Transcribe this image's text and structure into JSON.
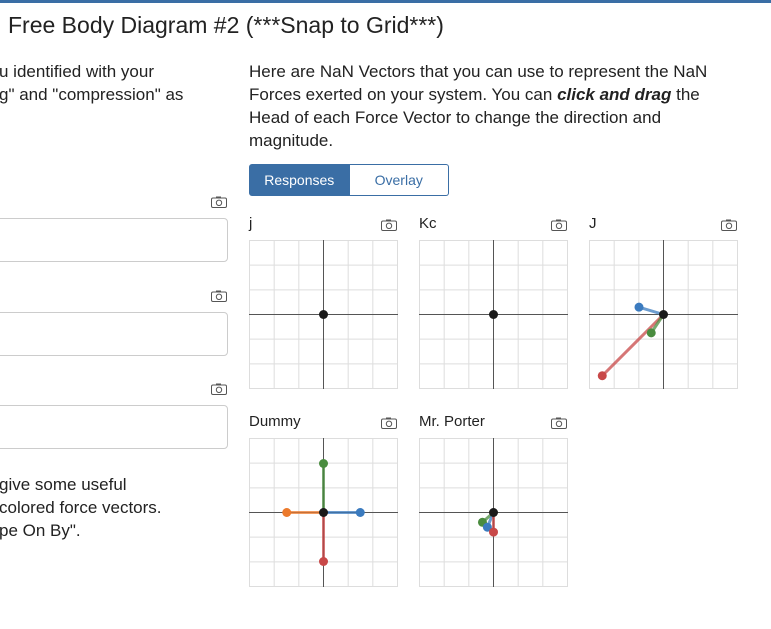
{
  "page": {
    "title": "Free Body Diagram #2 (***Snap to Grid***)",
    "left_text": [
      "u identified with your",
      "g\" and \"compression\" as"
    ],
    "right_text_a": "Here are NaN Vectors that you can use to represent the NaN Forces exerted on your system. You can ",
    "right_text_bold": "click and drag",
    "right_text_b": " the Head of each Force Vector to change the direction and magnitude.",
    "bottom_left_text": [
      "give some useful",
      "colored force vectors.",
      "pe On By\"."
    ]
  },
  "tabs": {
    "responses": "Responses",
    "overlay": "Overlay"
  },
  "colors": {
    "accent": "#3a6ea5",
    "blue": "#3b7bbf",
    "green": "#4a8c3f",
    "red": "#c84848",
    "orange": "#ec7a2c"
  },
  "panels": [
    {
      "label": "j",
      "vectors": []
    },
    {
      "label": "Kc",
      "vectors": []
    },
    {
      "label": "J",
      "vectors": [
        {
          "color": "blue",
          "x": -1,
          "y": 0.3
        },
        {
          "color": "red",
          "x": -2.5,
          "y": -2.5
        },
        {
          "color": "green",
          "x": -0.5,
          "y": -0.75
        }
      ]
    },
    {
      "label": "Dummy",
      "vectors": [
        {
          "color": "green",
          "x": 0,
          "y": 2
        },
        {
          "color": "blue",
          "x": 1.5,
          "y": 0
        },
        {
          "color": "orange",
          "x": -1.5,
          "y": 0
        },
        {
          "color": "red",
          "x": 0,
          "y": -2
        }
      ]
    },
    {
      "label": "Mr. Porter",
      "vectors": [
        {
          "color": "green",
          "x": -0.45,
          "y": -0.4
        },
        {
          "color": "blue",
          "x": -0.25,
          "y": -0.6
        },
        {
          "color": "red",
          "x": 0,
          "y": -0.8
        }
      ]
    }
  ]
}
